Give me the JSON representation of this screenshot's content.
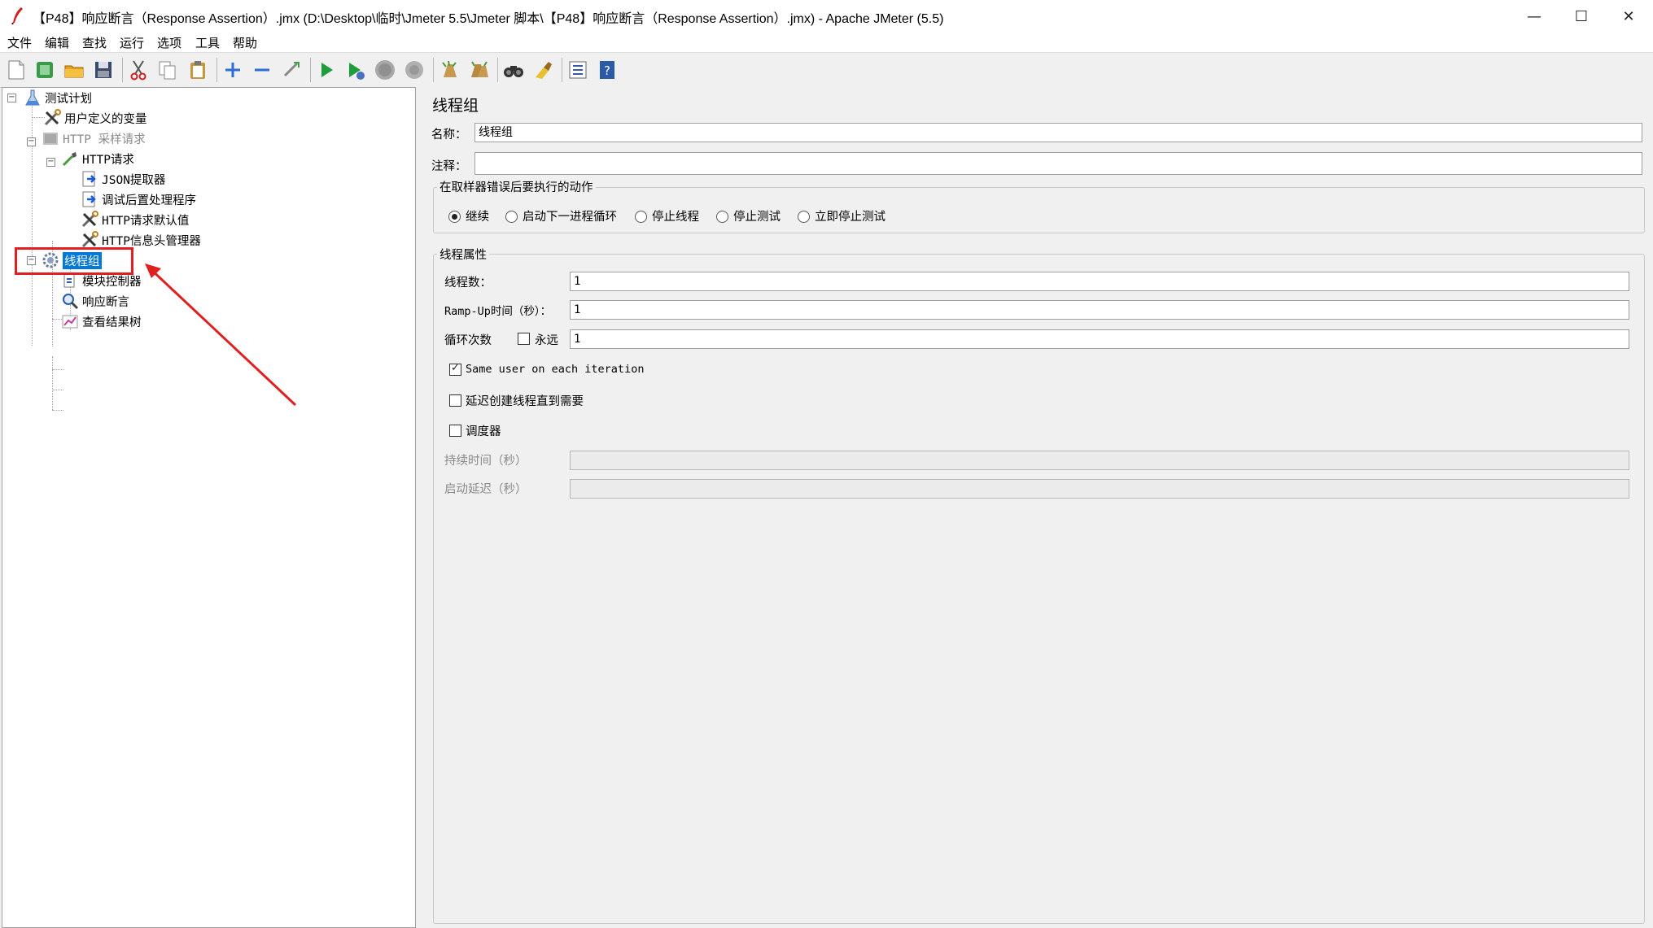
{
  "window": {
    "title": "【P48】响应断言（Response Assertion）.jmx (D:\\Desktop\\临时\\Jmeter 5.5\\Jmeter 脚本\\【P48】响应断言（Response Assertion）.jmx) - Apache JMeter (5.5)",
    "minimize": "—",
    "maximize": "☐",
    "close": "✕"
  },
  "menu": [
    "文件",
    "编辑",
    "查找",
    "运行",
    "选项",
    "工具",
    "帮助"
  ],
  "toolbar": {
    "icons": [
      "new-icon",
      "templates-icon",
      "open-icon",
      "save-icon",
      "cut-icon",
      "copy-icon",
      "paste-icon",
      "expand-icon",
      "collapse-icon",
      "toggle-icon",
      "start-icon",
      "start-no-pauses-icon",
      "stop-icon",
      "shutdown-icon",
      "clear-icon",
      "clear-all-icon",
      "search-icon",
      "reset-search-icon",
      "function-helper-icon",
      "help-icon"
    ]
  },
  "tree": [
    {
      "label": "测试计划",
      "icon": "test-plan-icon",
      "level": 0
    },
    {
      "label": "用户定义的变量",
      "icon": "tools-icon",
      "level": 1
    },
    {
      "label": "HTTP 采样请求",
      "icon": "disabled-sampler-icon",
      "level": 1,
      "disabled": true
    },
    {
      "label": "HTTP请求",
      "icon": "pipette-icon",
      "level": 2
    },
    {
      "label": "JSON提取器",
      "icon": "post-processor-icon",
      "level": 3
    },
    {
      "label": "调试后置处理程序",
      "icon": "post-processor-icon",
      "level": 3
    },
    {
      "label": "HTTP请求默认值",
      "icon": "tools-icon",
      "level": 3
    },
    {
      "label": "HTTP信息头管理器",
      "icon": "tools-icon",
      "level": 3
    },
    {
      "label": "线程组",
      "icon": "gear-icon",
      "level": 1,
      "selected": true
    },
    {
      "label": "模块控制器",
      "icon": "module-controller-icon",
      "level": 2
    },
    {
      "label": "响应断言",
      "icon": "magnifier-icon",
      "level": 2
    },
    {
      "label": "查看结果树",
      "icon": "results-tree-icon",
      "level": 2
    }
  ],
  "panel": {
    "heading": "线程组",
    "name_label": "名称：",
    "name_value": "线程组",
    "comment_label": "注释：",
    "comment_value": "",
    "error_action": {
      "title": "在取样器错误后要执行的动作",
      "options": [
        "继续",
        "启动下一进程循环",
        "停止线程",
        "停止测试",
        "立即停止测试"
      ],
      "selected": "继续"
    },
    "thread_props": {
      "title": "线程属性",
      "threads_label": "线程数：",
      "threads_value": "1",
      "rampup_label": "Ramp-Up时间（秒）：",
      "rampup_value": "1",
      "loop_label": "循环次数",
      "forever_label": "永远",
      "forever_checked": false,
      "loop_value": "1",
      "same_user_label": "Same user on each iteration",
      "same_user_checked": true,
      "delay_label": "延迟创建线程直到需要",
      "delay_checked": false,
      "scheduler_label": "调度器",
      "scheduler_checked": false,
      "duration_label": "持续时间（秒）",
      "duration_value": "",
      "startup_delay_label": "启动延迟（秒）",
      "startup_delay_value": ""
    }
  },
  "colors": {
    "annotation": "#e02020",
    "selection": "#0078d7"
  }
}
